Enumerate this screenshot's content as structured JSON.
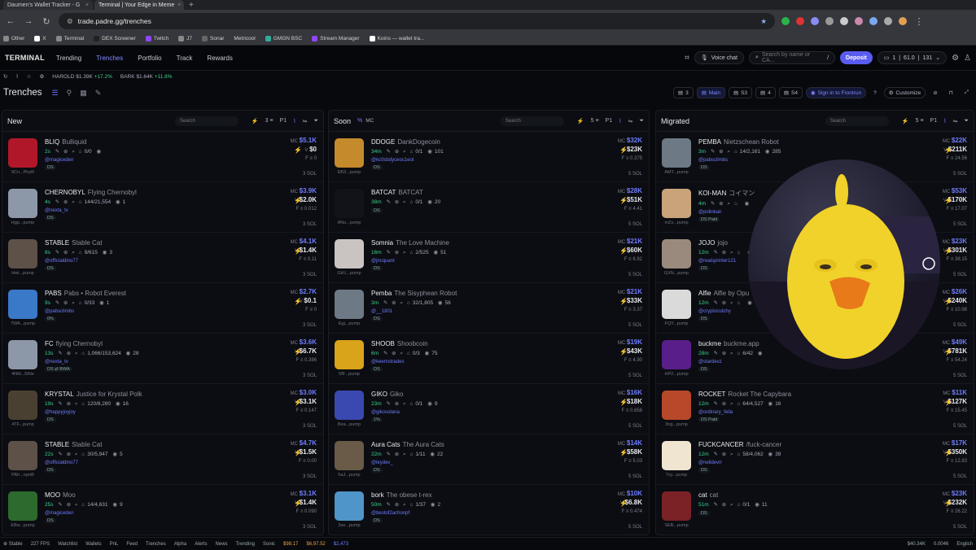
{
  "browser": {
    "tabs": [
      {
        "label": "Daumen's Wallet Tracker - G"
      },
      {
        "label": "Terminal | Your Edge in Meme"
      }
    ],
    "url": "trade.padre.gg/trenches",
    "bookmarks": [
      "Other",
      "X",
      "Terminal",
      "DEX Screener",
      "Twitch",
      "J7",
      "Sonar",
      "Metricool",
      "GMGN BSC",
      "Stream Manager",
      "Koins — wallet tra..."
    ]
  },
  "app": {
    "logo": "TERMINAL",
    "nav": [
      "Trending",
      "Trenches",
      "Portfolio",
      "Track",
      "Rewards"
    ],
    "voice_chat": "Voice chat",
    "search_placeholder": "Search by name or CA...",
    "search_shortcut": "/",
    "deposit": "Deposit",
    "wallet_count": "1",
    "balance": "61.0",
    "balance2": "131"
  },
  "ticker": [
    {
      "name": "HAROLD",
      "value": "$1.39K",
      "change": "+17.2%"
    },
    {
      "name": "BARK",
      "value": "$1.64K",
      "change": "+11.8%"
    }
  ],
  "toolbar": {
    "title": "Trenches",
    "chips": [
      "3",
      "Main",
      "S3",
      "4",
      "S4"
    ],
    "signin": "Sign in to Frontrun",
    "customize": "Customize"
  },
  "columns": [
    {
      "title": "New",
      "search": "Search",
      "count": "3",
      "preset": "P1",
      "cards": [
        {
          "ticker": "BLIQ",
          "name": "Bulliquid",
          "age": "2s",
          "holders": "0/0",
          "views": "",
          "handle": "@magiceden",
          "addr": "9Cn...PhyR",
          "tags": "DS",
          "mc": "$5.1K",
          "v": "$0",
          "f": "0",
          "sol": "3 SOL",
          "bg": "#b0182a"
        },
        {
          "ticker": "CHERNOBYL",
          "name": "Flying Chernobyl",
          "age": "4s",
          "holders": "144/21,554",
          "views": "1",
          "handle": "@nexta_tv",
          "addr": "Hgp...pump",
          "tags": "DS",
          "mc": "$3.9K",
          "v": "$2.0K",
          "f": "0.012",
          "sol": "3 SOL",
          "bg": "#8c97a8"
        },
        {
          "ticker": "STABLE",
          "name": "Stable Cat",
          "age": "8s",
          "holders": "9/615",
          "views": "3",
          "handle": "@officialdino77",
          "addr": "Hwi...pump",
          "tags": "DS",
          "mc": "$4.1K",
          "v": "$1.4K",
          "f": "0.11",
          "sol": "3 SOL",
          "bg": "#5e5148"
        },
        {
          "ticker": "PABS",
          "name": "Pabs • Robot Everest",
          "age": "9s",
          "holders": "0/33",
          "views": "1",
          "handle": "@pabsclimbs",
          "addr": "7WA...pump",
          "tags": "0%",
          "mc": "$2.7K",
          "v": "$0.1",
          "f": "0",
          "sol": "3 SOL",
          "bg": "#3a78c8"
        },
        {
          "ticker": "FC",
          "name": "flying Chernobyl",
          "age": "13s",
          "holders": "1,066/153,624",
          "views": "28",
          "handle": "@nexta_tv",
          "addr": "4NM...5tNe",
          "tags": "DS ⇄ BWA",
          "mc": "$3.6K",
          "v": "$6.7K",
          "f": "0.386",
          "sol": "3 SOL",
          "bg": "#8c97a8"
        },
        {
          "ticker": "KRYSTAL",
          "name": "Justice for Krystal Polk",
          "age": "19s",
          "holders": "120/8,280",
          "views": "16",
          "handle": "@happyjoyjoy",
          "addr": "4TF...pump",
          "tags": "DS",
          "mc": "$3.0K",
          "v": "$3.1K",
          "f": "0.147",
          "sol": "3 SOL",
          "bg": "#4a4032"
        },
        {
          "ticker": "STABLE",
          "name": "Stable Cat",
          "age": "22s",
          "holders": "30/5,947",
          "views": "5",
          "handle": "@officialdino77",
          "addr": "PAh...rqmB",
          "tags": "DS",
          "mc": "$4.7K",
          "v": "$1.5K",
          "f": "0.00",
          "sol": "3 SOL",
          "bg": "#5e5148"
        },
        {
          "ticker": "MOO",
          "name": "Moo",
          "age": "25s",
          "holders": "14/4,631",
          "views": "9",
          "handle": "@magiceden",
          "addr": "EBw...pump",
          "tags": "DS",
          "mc": "$3.1K",
          "v": "$1.4K",
          "f": "0.090",
          "sol": "3 SOL",
          "bg": "#2d6a2d"
        }
      ]
    },
    {
      "title": "Soon",
      "search": "Search",
      "count": "5",
      "preset": "P1",
      "mc_label": "MC",
      "cards": [
        {
          "ticker": "DDOGE",
          "name": "DankDogecoin",
          "age": "34m",
          "holders": "0/1",
          "views": "101",
          "handle": "@kc0sbdyceoc1eol",
          "addr": "EB3...pump",
          "tags": "DS",
          "mc": "$32K",
          "v": "$23K",
          "f": "0.375",
          "sol": "5 SOL",
          "bg": "#c58a2c"
        },
        {
          "ticker": "BATCAT",
          "name": "BATCAT",
          "age": "38m",
          "holders": "0/1",
          "views": "20",
          "handle": "",
          "addr": "ANs...pump",
          "tags": "DS",
          "mc": "$28K",
          "v": "$51K",
          "f": "4.41",
          "sol": "5 SOL",
          "bg": "#111318"
        },
        {
          "ticker": "Somnia",
          "name": "The Love Machine",
          "age": "16m",
          "holders": "2/525",
          "views": "51",
          "handle": "@jncquant",
          "addr": "GkU...pump",
          "tags": "DS",
          "mc": "$21K",
          "v": "$60K",
          "f": "6.92",
          "sol": "5 SOL",
          "bg": "#c9c4c2"
        },
        {
          "ticker": "Pemba",
          "name": "The Sisyphean Robot",
          "age": "3m",
          "holders": "32/1,805",
          "views": "56",
          "handle": "@__1801",
          "addr": "Egj...pump",
          "tags": "DS",
          "mc": "$21K",
          "v": "$33K",
          "f": "3.37",
          "sol": "5 SOL",
          "bg": "#6d7a86"
        },
        {
          "ticker": "SHOOB",
          "name": "Shoobcoin",
          "age": "6m",
          "holders": "0/3",
          "views": "75",
          "handle": "@keemstrades",
          "addr": "5fF...pump",
          "tags": "DS",
          "mc": "$19K",
          "v": "$43K",
          "f": "4.90",
          "sol": "5 SOL",
          "bg": "#d9a31a"
        },
        {
          "ticker": "GIKO",
          "name": "Giko",
          "age": "23m",
          "holders": "0/1",
          "views": "9",
          "handle": "@gikosolana",
          "addr": "Bea...pump",
          "tags": "1%",
          "mc": "$16K",
          "v": "$18K",
          "f": "0.656",
          "sol": "5 SOL",
          "bg": "#3a49b0"
        },
        {
          "ticker": "Aura Cats",
          "name": "The Aura Cats",
          "age": "22m",
          "holders": "1/11",
          "views": "22",
          "handle": "@leydev_",
          "addr": "5aJ...pump",
          "tags": "DS",
          "mc": "$14K",
          "v": "$58K",
          "f": "5.03",
          "sol": "5 SOL",
          "bg": "#6a5a48"
        },
        {
          "ticker": "bork",
          "name": "The obese t-rex",
          "age": "50m",
          "holders": "1/37",
          "views": "2",
          "handle": "@bestof2achonpf",
          "addr": "3se...pump",
          "tags": "DS",
          "mc": "$10K",
          "v": "$6.8K",
          "f": "0.474",
          "sol": "5 SOL",
          "bg": "#4f95c9"
        }
      ]
    },
    {
      "title": "Migrated",
      "search": "Search",
      "count": "5",
      "preset": "P1",
      "cards": [
        {
          "ticker": "PEMBA",
          "name": "Nietzschean Robot",
          "age": "3m",
          "holders": "14/2,161",
          "views": "285",
          "handle": "@pabsclimbs",
          "addr": "AMT...pump",
          "tags": "DS",
          "mc": "$22K",
          "v": "$211K",
          "f": "24.56",
          "sol": "5 SOL",
          "bg": "#6d7a86"
        },
        {
          "ticker": "KOI-MAN",
          "name": "コイマン",
          "age": "4m",
          "holders": "",
          "views": "",
          "handle": "@polinkaii",
          "addr": "mZs...pump",
          "tags": "DS  Paid",
          "mc": "$53K",
          "v": "$170K",
          "f": "17.07",
          "sol": "5 SOL",
          "bg": "#c9a37a"
        },
        {
          "ticker": "JOJO",
          "name": "jojo",
          "age": "12m",
          "holders": "",
          "views": "",
          "handle": "@realsprinter121",
          "addr": "GXN...pump",
          "tags": "DS",
          "mc": "$23K",
          "v": "$301K",
          "f": "38.15",
          "sol": "5 SOL",
          "bg": "#9a8a7e"
        },
        {
          "ticker": "Alfie",
          "name": "Alfie by Opu",
          "age": "12m",
          "holders": "",
          "views": "",
          "handle": "@cryptocutchy",
          "addr": "FQY...pump",
          "tags": "DS",
          "mc": "$26K",
          "v": "$240K",
          "f": "10.98",
          "sol": "5 SOL",
          "bg": "#dadada"
        },
        {
          "ticker": "buckme",
          "name": "buckme.app",
          "age": "28m",
          "holders": "6/42",
          "views": "",
          "handle": "@stardevz",
          "addr": "HP2...pump",
          "tags": "DS",
          "mc": "$49K",
          "v": "$781K",
          "f": "54.24",
          "sol": "5 SOL",
          "bg": "#5a1e8a"
        },
        {
          "ticker": "ROCKET",
          "name": "Rocket The Capybara",
          "age": "12m",
          "holders": "64/4,527",
          "views": "16",
          "handle": "@ordinary_fella",
          "addr": "3ng...pump",
          "tags": "DS  Paid",
          "mc": "$11K",
          "v": "$127K",
          "f": "15.45",
          "sol": "5 SOL",
          "bg": "#b8482a"
        },
        {
          "ticker": "FUCKCANCER",
          "name": "/fuck-cancer",
          "age": "12m",
          "holders": "58/4,062",
          "views": "39",
          "handle": "@nelidevrr",
          "addr": "7vy...pump",
          "tags": "DS",
          "mc": "$17K",
          "v": "$350K",
          "f": "12.83",
          "sol": "5 SOL",
          "bg": "#efe5d1"
        },
        {
          "ticker": "cat",
          "name": "cat",
          "age": "51m",
          "holders": "0/1",
          "views": "11",
          "handle": "",
          "addr": "SEB...pump",
          "tags": "DS",
          "mc": "$23K",
          "v": "$232K",
          "f": "26.22",
          "sol": "5 SOL",
          "bg": "#7b2226"
        }
      ]
    }
  ],
  "statusbar": {
    "preset": "Stable",
    "fps": "227 FPS",
    "items": [
      "Watchlist",
      "Wallets",
      "PnL",
      "Feed",
      "Trenches",
      "Alpha",
      "Alerts",
      "News",
      "Trending",
      "Sonic"
    ],
    "prices": [
      "$98.17",
      "$6,97.52",
      "$2,473"
    ],
    "right": [
      "$40.34K",
      "0.0046",
      "English"
    ]
  },
  "colors": {
    "accent": "#6f7cff",
    "green": "#3ad28c",
    "bg": "#08090d"
  }
}
